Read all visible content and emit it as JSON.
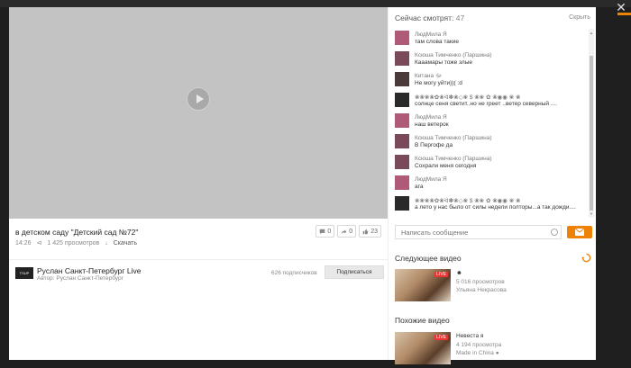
{
  "video": {
    "title": "в детском саду \"Детский сад №72\"",
    "time": "14:26",
    "views": "1 425 просмотров",
    "download_label": "Скачать",
    "reactions": {
      "comments": "0",
      "shares": "0",
      "likes": "23"
    }
  },
  "author": {
    "logo_text": "TSUP",
    "name": "Руслан Санкт-Петербург Live",
    "subtitle": "Автор: Руслан Санкт-Петербург",
    "subscribers": "626 подписчиков",
    "subscribe_label": "Подписаться"
  },
  "watching": {
    "label": "Сейчас смотрят:",
    "count": "47",
    "hide_label": "Скрыть"
  },
  "chat": [
    {
      "name": "ЛюдМила Я",
      "text": "там слова такие",
      "avatar": "#b05a7a"
    },
    {
      "name": "Ксюша Тимченко (Паршина)",
      "text": "Кааамары тоже злые",
      "avatar": "#7a4a5a"
    },
    {
      "name": "Китана ﷻ",
      "text": "Не могу уйти))( :d",
      "avatar": "#4a3a3a"
    },
    {
      "name": "❀❀❀❀✿❀ᐛ✽❀◇❀ $ ❀❀ ✿ ❀◉◉ ❀ ❀",
      "text": "солнце сеня светит..но не греет ..ветер северный ....",
      "avatar": "#2a2a2a"
    },
    {
      "name": "ЛюдМила Я",
      "text": "наш ветерок",
      "avatar": "#b05a7a"
    },
    {
      "name": "Ксюша Тимченко (Паршина)",
      "text": "В Пергофе да",
      "avatar": "#7a4a5a"
    },
    {
      "name": "Ксюша Тимченко (Паршина)",
      "text": "Сохрали меня сегодня",
      "avatar": "#7a4a5a"
    },
    {
      "name": "ЛюдМила Я",
      "text": "ага",
      "avatar": "#b05a7a"
    },
    {
      "name": "❀❀❀❀✿❀ᐛ✽❀◇❀ $ ❀❀ ✿ ❀◉◉ ❀ ❀",
      "text": "а лето у нас было от силы недели полторы...а так дожди....",
      "avatar": "#2a2a2a"
    }
  ],
  "input": {
    "placeholder": "Написать сообщение"
  },
  "next": {
    "heading": "Следующее видео",
    "card": {
      "live_label": "LIVE",
      "title": "☻",
      "views": "5 016 просмотров",
      "author": "Ульяна Некрасова"
    }
  },
  "similar": {
    "heading": "Похожие видео",
    "card": {
      "live_label": "LIVE",
      "title": "Невеста я",
      "views": "4 194 просмотра",
      "author": "Made in China ●"
    }
  },
  "colors": {
    "accent": "#ee8208",
    "live": "#e33333"
  },
  "icons": {
    "close": "close-icon",
    "play": "play-icon",
    "comment": "comment-icon",
    "share": "share-icon",
    "like": "like-icon",
    "smile": "smile-icon",
    "send": "send-icon",
    "autoplay": "autoplay-icon"
  }
}
